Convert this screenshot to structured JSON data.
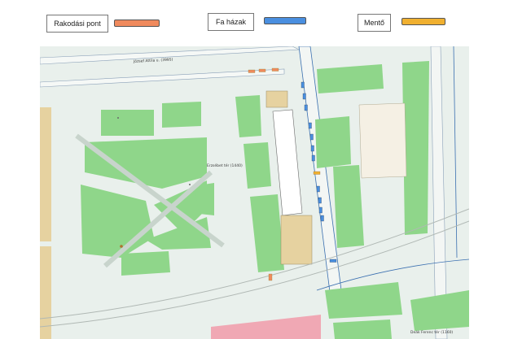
{
  "legend": {
    "items": [
      {
        "label": "Rakodási pont",
        "color": "#f08a5d"
      },
      {
        "label": "Fa házak",
        "color": "#4a8fe0"
      },
      {
        "label": "Mentő",
        "color": "#f0b030"
      }
    ]
  },
  "map": {
    "street_labels": {
      "top": "József Attila u. (3995)",
      "square": "Erzsébet tér (1440)",
      "bottom_right": "Deák Ferenc tér (1160)"
    },
    "colors": {
      "park": "#8fd68a",
      "background": "#e9f0ec",
      "building": "#e6d2a0",
      "pink": "#f0a8b4",
      "road_edge": "#3a6fb0"
    }
  }
}
